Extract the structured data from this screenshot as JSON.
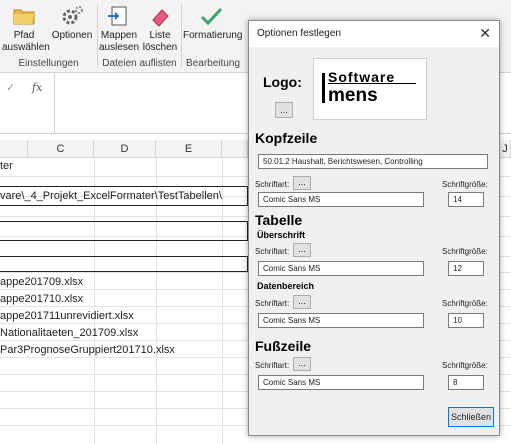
{
  "ribbon": {
    "buttons": [
      {
        "label": "Pfad\nauswählen",
        "icon": "folder-icon"
      },
      {
        "label": "Optionen",
        "icon": "gear-icon"
      },
      {
        "label": "Mappen\nauslesen",
        "icon": "import-icon"
      },
      {
        "label": "Liste\nlöschen",
        "icon": "eraser-icon"
      },
      {
        "label": "Formatierung",
        "icon": "checkmark-icon"
      }
    ],
    "groups": [
      "Einstellungen",
      "Dateien auflisten",
      "Bearbeitung"
    ]
  },
  "formula_bar": {
    "cancel": "✓",
    "fx": "fx"
  },
  "columns": [
    "C",
    "D",
    "E",
    "J"
  ],
  "sheet": {
    "cells": [
      "ter",
      "vare\\_4_Projekt_ExcelFormater\\TestTabellen\\",
      "appe201709.xlsx",
      "appe201710.xlsx",
      "appe201711unrevidiert.xlsx",
      "Nationalitaeten_201709.xlsx",
      "Par3PrognoseGruppiert201710.xlsx"
    ]
  },
  "dialog": {
    "title": "Optionen festlegen",
    "close": "✕",
    "logo_label": "Logo:",
    "browse": "...",
    "logo_text_top": "Software",
    "logo_text_bottom": "mens",
    "kopfzeile": {
      "heading": "Kopfzeile",
      "value": "50.01.2 Haushalt, Berichtswesen, Controlling",
      "font_label": "Schriftart:",
      "font_value": "Comic Sans MS",
      "size_label": "Schriftgröße:",
      "size_value": "14"
    },
    "tabelle": {
      "heading": "Tabelle",
      "ueberschrift": {
        "heading": "Überschrift",
        "font_label": "Schriftart:",
        "font_value": "Comic Sans MS",
        "size_label": "Schriftgröße:",
        "size_value": "12"
      },
      "datenbereich": {
        "heading": "Datenbereich",
        "font_label": "Schriftart:",
        "font_value": "Comic Sans MS",
        "size_label": "Schriftgröße:",
        "size_value": "10"
      }
    },
    "fusszeile": {
      "heading": "Fußzeile",
      "font_label": "Schriftart:",
      "font_value": "Comic Sans MS",
      "size_label": "Schriftgröße:",
      "size_value": "8"
    },
    "close_button": "Schließen"
  }
}
